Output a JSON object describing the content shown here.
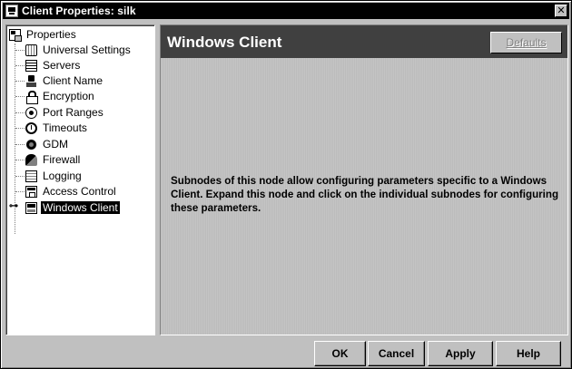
{
  "window": {
    "title": "Client Properties: silk",
    "close_glyph": "✕"
  },
  "tree": {
    "root": {
      "label": "Properties",
      "icon": "properties-icon"
    },
    "items": [
      {
        "label": "Universal Settings",
        "icon": "globe-icon"
      },
      {
        "label": "Servers",
        "icon": "server-icon"
      },
      {
        "label": "Client Name",
        "icon": "person-icon"
      },
      {
        "label": "Encryption",
        "icon": "lock-icon"
      },
      {
        "label": "Port Ranges",
        "icon": "radio-icon"
      },
      {
        "label": "Timeouts",
        "icon": "clock-icon"
      },
      {
        "label": "GDM",
        "icon": "gear-icon"
      },
      {
        "label": "Firewall",
        "icon": "firewall-icon"
      },
      {
        "label": "Logging",
        "icon": "logging-icon"
      },
      {
        "label": "Access Control",
        "icon": "access-control-icon"
      },
      {
        "label": "Windows Client",
        "icon": "windows-client-icon",
        "selected": true,
        "expander": "⊶"
      }
    ]
  },
  "panel": {
    "title": "Windows Client",
    "defaults_label": "Defaults",
    "description": "Subnodes of this node allow configuring parameters specific to a Windows Client. Expand this node and click on the individual subnodes for configuring these parameters."
  },
  "buttons": {
    "ok": "OK",
    "cancel": "Cancel",
    "apply": "Apply",
    "help": "Help"
  },
  "colors": {
    "title_bar": "#000000",
    "panel_header": "#404040",
    "window_bg": "#c0c0c0",
    "selection": "#000000"
  }
}
